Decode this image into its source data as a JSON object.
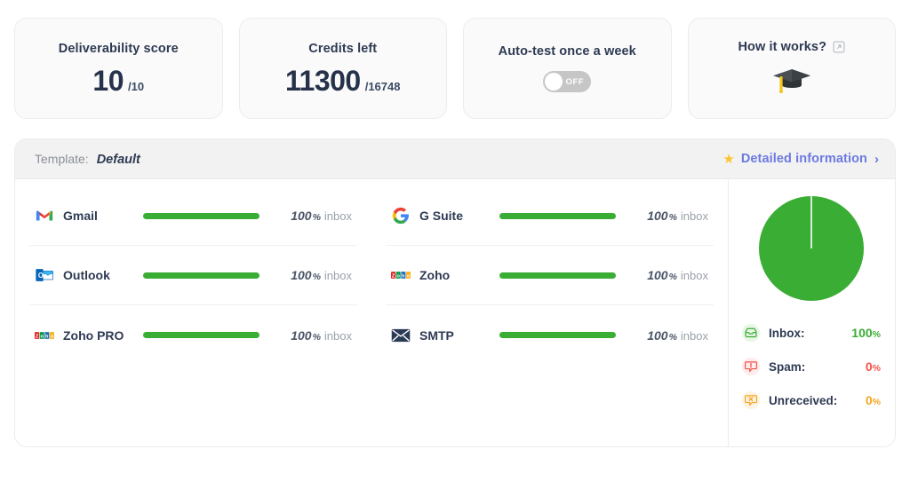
{
  "stats": [
    {
      "title": "Deliverability score",
      "value": "10",
      "sub": "/10",
      "name": "deliverability-score-card"
    },
    {
      "title": "Credits left",
      "value": "11300",
      "sub": "/16748",
      "name": "credits-left-card"
    },
    {
      "title": "Auto-test once a week",
      "toggle_state": "OFF",
      "toggle_on": false,
      "name": "auto-test-card"
    },
    {
      "title": "How it works?",
      "icon": "graduation-cap-icon",
      "external_icon": "external-link-icon",
      "name": "how-it-works-card"
    }
  ],
  "panel": {
    "template_label": "Template:",
    "template_value": "Default",
    "detailed_link": "Detailed information",
    "star_icon": "star-icon",
    "chevron_icon": "chevron-right-icon"
  },
  "providers": [
    {
      "name": "Gmail",
      "logo": "gmail-logo",
      "percent": "100",
      "sign": "%",
      "word": "inbox",
      "fill": 100
    },
    {
      "name": "G Suite",
      "logo": "gsuite-logo",
      "percent": "100",
      "sign": "%",
      "word": "inbox",
      "fill": 100
    },
    {
      "name": "Outlook",
      "logo": "outlook-logo",
      "percent": "100",
      "sign": "%",
      "word": "inbox",
      "fill": 100
    },
    {
      "name": "Zoho",
      "logo": "zoho-logo",
      "percent": "100",
      "sign": "%",
      "word": "inbox",
      "fill": 100
    },
    {
      "name": "Zoho PRO",
      "logo": "zoho-logo",
      "percent": "100",
      "sign": "%",
      "word": "inbox",
      "fill": 100
    },
    {
      "name": "SMTP",
      "logo": "smtp-logo",
      "percent": "100",
      "sign": "%",
      "word": "inbox",
      "fill": 100
    }
  ],
  "legend": [
    {
      "label": "Inbox:",
      "value": "100",
      "unit": "%",
      "color": "#3aad34",
      "icon": "inbox-icon"
    },
    {
      "label": "Spam:",
      "value": "0",
      "unit": "%",
      "color": "#f3534a",
      "icon": "spam-alert-icon"
    },
    {
      "label": "Unreceived:",
      "value": "0",
      "unit": "%",
      "color": "#f5a623",
      "icon": "unreceived-icon"
    }
  ],
  "chart_data": {
    "type": "pie",
    "title": "Delivery distribution",
    "categories": [
      "Inbox",
      "Spam",
      "Unreceived"
    ],
    "values": [
      100,
      0,
      0
    ],
    "colors": [
      "#3aad34",
      "#f3534a",
      "#f5a623"
    ],
    "legend_position": "bottom",
    "units": "%"
  },
  "colors": {
    "bar_green": "#3aad34",
    "accent_link": "#6c7ae0",
    "star": "#ffc531",
    "text_dark": "#2e3a53",
    "muted": "#9aa0ab"
  }
}
